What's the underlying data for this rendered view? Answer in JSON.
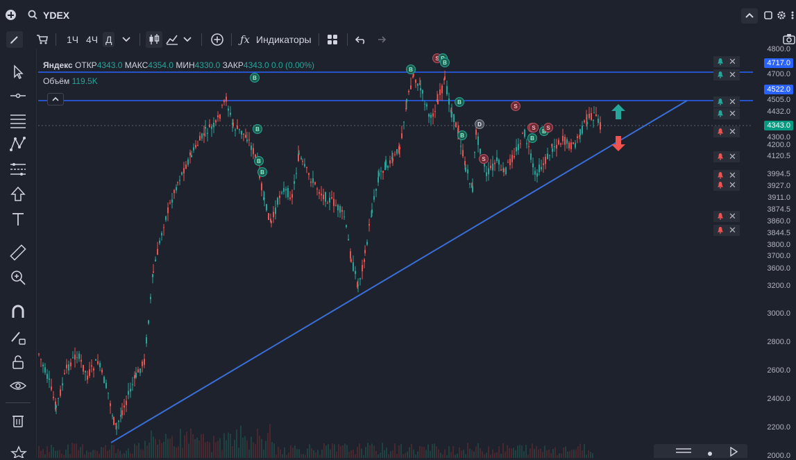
{
  "header": {
    "symbol": "YDEX"
  },
  "toolbar": {
    "timeframes": [
      "1Ч",
      "4Ч",
      "Д"
    ],
    "indicators_label": "Индикаторы"
  },
  "legend": {
    "name": "Яндекс",
    "open_label": "ОТКР",
    "open": "4343.0",
    "high_label": "МАКС",
    "high": "4354.0",
    "low_label": "МИН",
    "low": "4330.0",
    "close_label": "ЗАКР",
    "close": "4343.0",
    "change": "0.0 (0.00%)",
    "volume_label": "Объём",
    "volume": "119.5K"
  },
  "price_axis": {
    "labels": [
      "4800.0",
      "4700.0",
      "4505.0",
      "4432.0",
      "4300.0",
      "4200.0",
      "4120.5",
      "3994.5",
      "3927.0",
      "3911.0",
      "3874.5",
      "3860.0",
      "3844.5",
      "3800.0",
      "3700.0",
      "3600.0",
      "3200.0",
      "3000.0",
      "2800.0",
      "2600.0",
      "2400.0",
      "2200.0",
      "2000.0"
    ],
    "tags": [
      {
        "label": "4717.0",
        "color": "#2962ff"
      },
      {
        "label": "4522.0",
        "color": "#2962ff"
      },
      {
        "label": "4343.0",
        "color": "#089981"
      }
    ]
  },
  "alerts": [
    {
      "kind": "up",
      "price": "4717.0"
    },
    {
      "kind": "up",
      "price": "4700.0"
    },
    {
      "kind": "up",
      "price": "4505.0"
    },
    {
      "kind": "up",
      "price": "4432.0"
    },
    {
      "kind": "down",
      "price": "4343.0"
    },
    {
      "kind": "down",
      "price": "4120.5"
    },
    {
      "kind": "down",
      "price": "3994.5"
    },
    {
      "kind": "down",
      "price": "3927.0"
    },
    {
      "kind": "down",
      "price": "3860.0"
    },
    {
      "kind": "down",
      "price": "3844.5"
    }
  ],
  "markers": [
    {
      "label": "S",
      "kind": "s"
    },
    {
      "label": "B",
      "kind": "b"
    },
    {
      "label": "B",
      "kind": "b"
    },
    {
      "label": "B",
      "kind": "b"
    },
    {
      "label": "B",
      "kind": "b"
    },
    {
      "label": "B",
      "kind": "b"
    },
    {
      "label": "B",
      "kind": "b"
    },
    {
      "label": "B",
      "kind": "b"
    },
    {
      "label": "B",
      "kind": "b"
    },
    {
      "label": "S",
      "kind": "s"
    },
    {
      "label": "D",
      "kind": "d"
    },
    {
      "label": "B",
      "kind": "b"
    },
    {
      "label": "S",
      "kind": "s"
    },
    {
      "label": "B",
      "kind": "b"
    },
    {
      "label": "B",
      "kind": "b"
    },
    {
      "label": "S",
      "kind": "s"
    },
    {
      "label": "S",
      "kind": "s"
    },
    {
      "label": "S",
      "kind": "s"
    }
  ],
  "colors": {
    "up": "#26a69a",
    "down": "#ef5350",
    "line": "#2962ff",
    "trend": "#3a6fd8",
    "bg": "#1e222d"
  },
  "icons": [
    "pencil-icon",
    "cart-icon",
    "candles-icon",
    "line-chart-icon",
    "plus-circle-icon",
    "fx-icon",
    "grid-icon",
    "undo-icon",
    "redo-icon",
    "camera-icon",
    "cursor-icon",
    "line-tool-icon",
    "fib-icon",
    "pattern-icon",
    "projection-icon",
    "arrow-icon",
    "text-icon",
    "ruler-icon",
    "zoom-icon",
    "magnet-icon",
    "pencil-lock-icon",
    "lock-icon",
    "eye-icon",
    "trash-icon",
    "star-icon",
    "settings-icon"
  ]
}
